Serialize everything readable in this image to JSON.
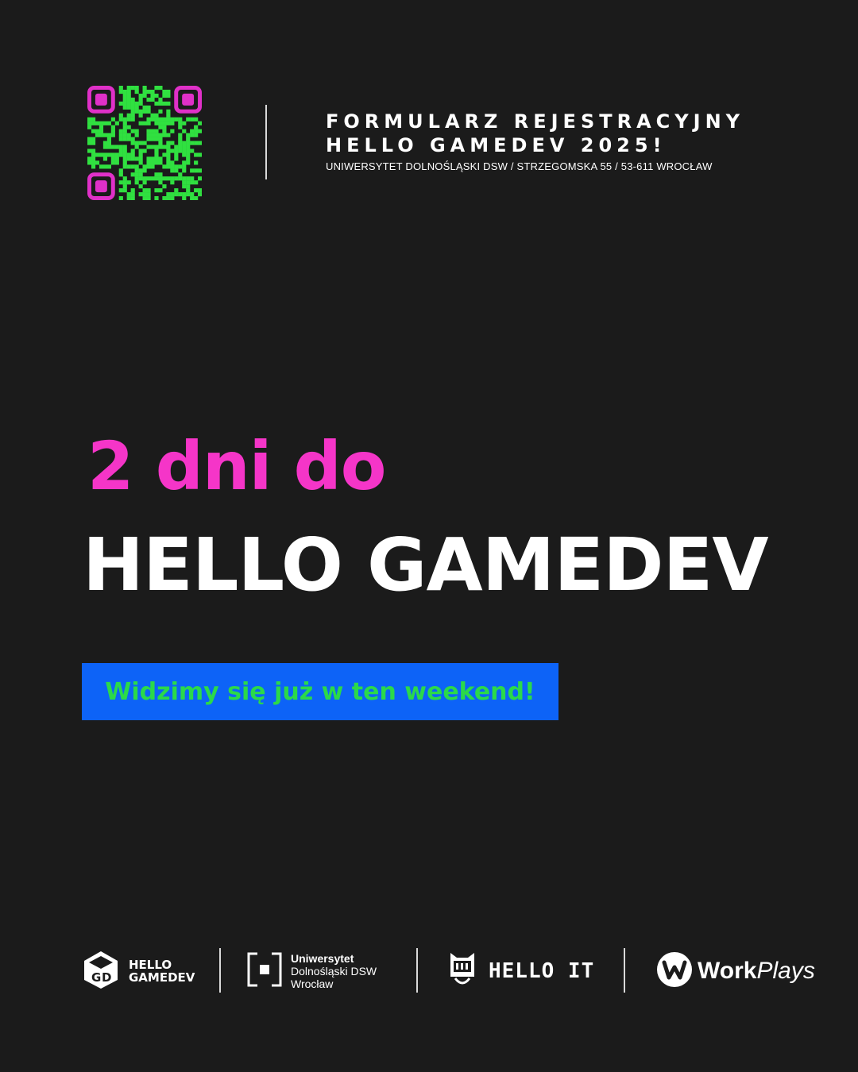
{
  "header": {
    "line1": "FORMULARZ REJESTRACYJNY",
    "line2": "HELLO GAMEDEV 2025!",
    "address": "UNIWERSYTET DOLNOŚLĄSKI DSW  /  STRZEGOMSKA 55  /  53-611 WROCŁAW"
  },
  "headline": {
    "line1": "2 dni do",
    "line2": "HELLO GAMEDEV"
  },
  "tagline": "Widzimy się już w ten weekend!",
  "footer": {
    "hello_gamedev": {
      "line1": "HELLO",
      "line2": "GAMEDEV"
    },
    "dsw": {
      "line1": "Uniwersytet",
      "line2": "Dolnośląski DSW",
      "line3": "Wrocław"
    },
    "hello_it": "HELLO IT",
    "workplays": {
      "part1": "Work",
      "part2": "Plays"
    }
  },
  "colors": {
    "background": "#1b1b1b",
    "accent_pink": "#f535c8",
    "accent_green": "#2bd94a",
    "tag_blue": "#0d63f7",
    "qr_magenta": "#e030c8",
    "qr_green": "#30e040"
  },
  "icons": {
    "qr": "qr-code-icon",
    "hello_gamedev_logo": "hello-gamedev-cube-icon",
    "dsw_logo": "dsw-bracket-square-icon",
    "hello_it_logo": "hello-it-cat-icon",
    "workplays_logo": "workplays-w-circle-icon"
  }
}
